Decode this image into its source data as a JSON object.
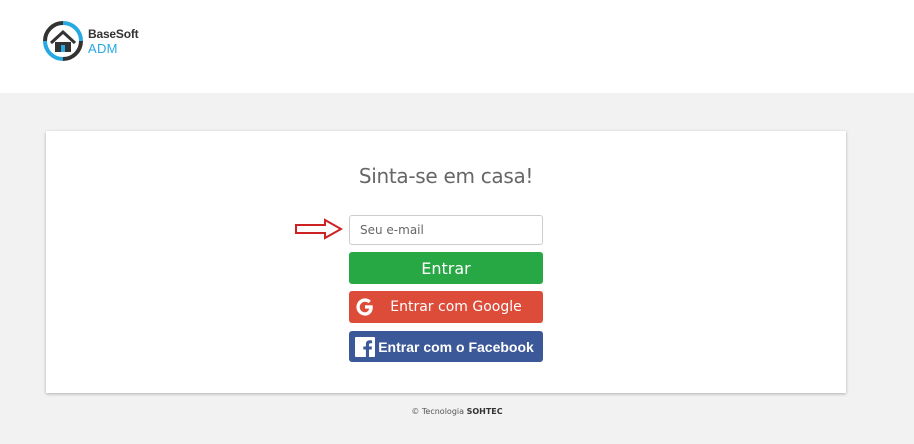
{
  "header": {
    "brand": "BaseSoft",
    "product": "ADM"
  },
  "login": {
    "headline": "Sinta-se em casa!",
    "email_placeholder": "Seu e-mail",
    "submit_label": "Entrar",
    "google_label": "Entrar com Google",
    "facebook_label": "Entrar com o Facebook"
  },
  "footer": {
    "prefix": "© Tecnologia",
    "company": "SOHTEC"
  },
  "colors": {
    "submit": "#28a745",
    "google": "#dd4b39",
    "facebook": "#3b5998",
    "brand_accent": "#27a9e1",
    "arrow": "#cc2222"
  }
}
